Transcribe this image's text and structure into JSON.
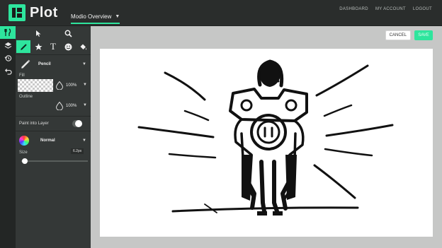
{
  "app": {
    "name": "Plot"
  },
  "project": {
    "title": "Modio Overview"
  },
  "nav": {
    "dashboard": "DASHBOARD",
    "account": "MY ACCOUNT",
    "logout": "LOGOUT"
  },
  "toolbar": {
    "text_tool": "T"
  },
  "brush": {
    "name": "Pencil"
  },
  "fill": {
    "label": "Fill",
    "opacity": "100%"
  },
  "outline": {
    "label": "Outline",
    "opacity": "100%"
  },
  "paint_into_layer": {
    "label": "Paint into Layer",
    "enabled": true
  },
  "blend": {
    "mode": "Normal"
  },
  "size": {
    "label": "Size",
    "value": "6.2px",
    "level": 0.05
  },
  "actions": {
    "cancel": "CANCEL",
    "save": "SAVE"
  },
  "colors": {
    "accent": "#2ee59d",
    "topbar": "#2a2d2c",
    "panel": "#343837",
    "workspace": "#c6c7c6"
  }
}
